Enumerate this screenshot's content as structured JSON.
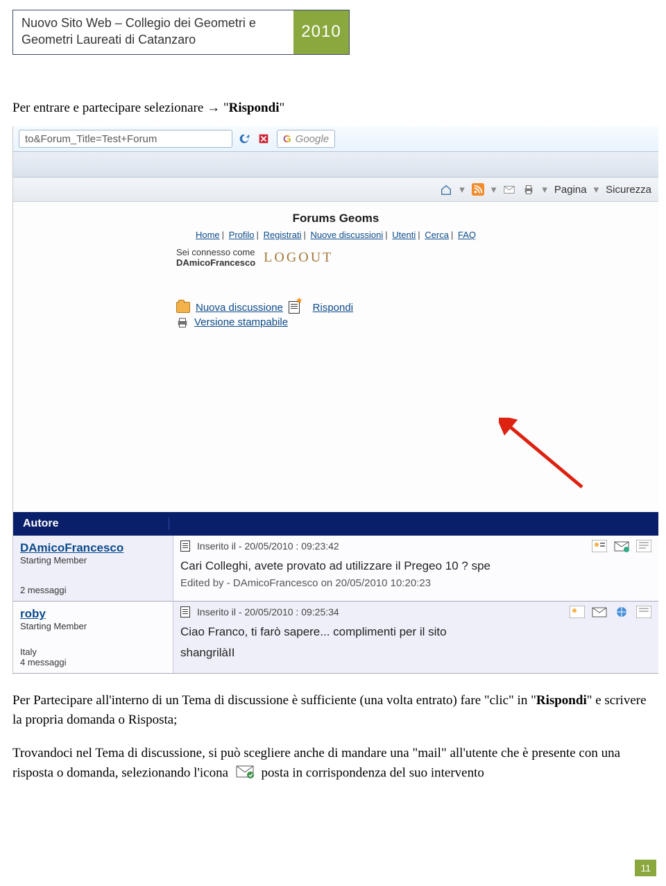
{
  "header": {
    "title_line1": "Nuovo Sito Web – Collegio dei Geometri e",
    "title_line2": "Geometri Laureati di Catanzaro",
    "year": "2010"
  },
  "p1_pre": "Per entrare e partecipare selezionare ",
  "p1_arrow": "→",
  "p1_q1": " \"",
  "p1_bold": "Rispondi",
  "p1_q2": "\"",
  "screenshot": {
    "url": "to&Forum_Title=Test+Forum",
    "search_placeholder": "Google",
    "toolbar": {
      "pagina": "Pagina",
      "sicurezza": "Sicurezza"
    },
    "forum_title": "Forums Geoms",
    "nav": [
      "Home",
      "Profilo",
      "Registrati",
      "Nuove discussioni",
      "Utenti",
      "Cerca",
      "FAQ"
    ],
    "login_label": "Sei connesso come",
    "login_user": "DAmicoFrancesco",
    "logout": "LOGOUT",
    "action_new": "Nuova discussione",
    "action_reply": "Rispondi",
    "action_print": "Versione stampabile",
    "table_header": "Autore",
    "posts": [
      {
        "author": "DAmicoFrancesco",
        "role": "Starting Member",
        "msgcount": "2 messaggi",
        "posted": "Inserito il - 20/05/2010 :  09:23:42",
        "body": "Cari Colleghi, avete provato ad utilizzare il Pregeo 10 ? spe",
        "edited": "Edited by - DAmicoFrancesco on 20/05/2010 10:20:23"
      },
      {
        "author": "roby",
        "role": "Starting Member",
        "country": "Italy",
        "msgcount": "4 messaggi",
        "posted": "Inserito il - 20/05/2010 :  09:25:34",
        "body": "Ciao Franco, ti farò sapere... complimenti per il sito",
        "sig": "shangrilàII"
      }
    ]
  },
  "p2_a": "Per Partecipare all'interno di un Tema di discussione è sufficiente (una volta entrato) fare \"clic\" in \"",
  "p2_b": "Rispondi",
  "p2_c": "\" e scrivere la propria domanda o Risposta;",
  "p3_a": "Trovandoci nel Tema di discussione, si può scegliere anche di mandare una \"mail\" all'utente che è presente con una risposta o domanda, selezionando l'icona",
  "p3_b": "posta in corrispondenza del suo intervento",
  "page_number": "11"
}
